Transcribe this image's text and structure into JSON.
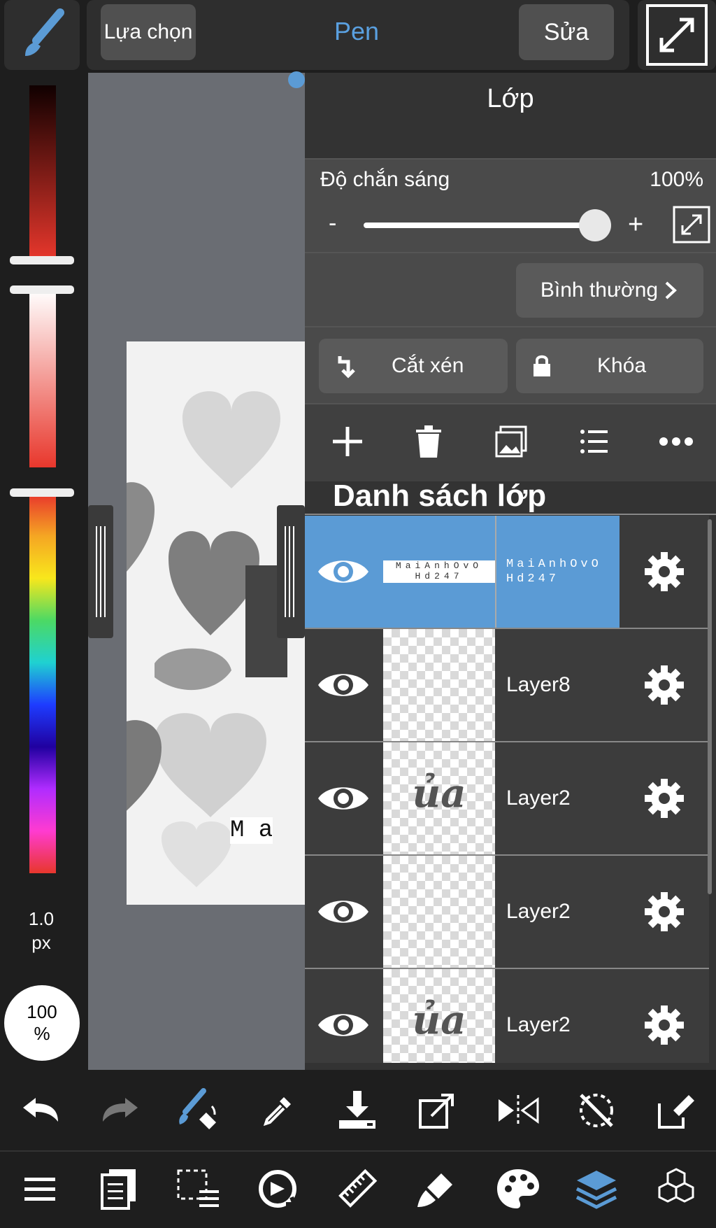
{
  "topbar": {
    "select_label": "Lựa chọn",
    "tool_name": "Pen",
    "edit_label": "Sửa"
  },
  "left_rail": {
    "brush_size_value": "1.0",
    "brush_size_unit": "px",
    "opacity_value": "100",
    "opacity_unit": "%"
  },
  "layer_panel": {
    "title": "Lớp",
    "opacity_label": "Độ chắn sáng",
    "opacity_value": "100%",
    "opacity_level": 0.88,
    "minus": "-",
    "plus": "+",
    "blend_mode": "Bình thường",
    "clip_label": "Cắt xén",
    "lock_label": "Khóa",
    "list_title": "Danh sách lớp",
    "layers": [
      {
        "name": "MaiAnhOvO Hd247",
        "thumb_text": "MaiAnhOvO Hd247",
        "selected": true
      },
      {
        "name": "Layer8",
        "selected": false
      },
      {
        "name": "Layer2",
        "thumb_text": "ủa",
        "selected": false
      },
      {
        "name": "Layer2",
        "thumb_text": "",
        "selected": false
      },
      {
        "name": "Layer2",
        "thumb_text": "ủa",
        "selected": false
      }
    ]
  },
  "canvas": {
    "art_text": "M a"
  },
  "colors": {
    "accent": "#5b9bd5",
    "pen_title": "#5aa0e0"
  }
}
